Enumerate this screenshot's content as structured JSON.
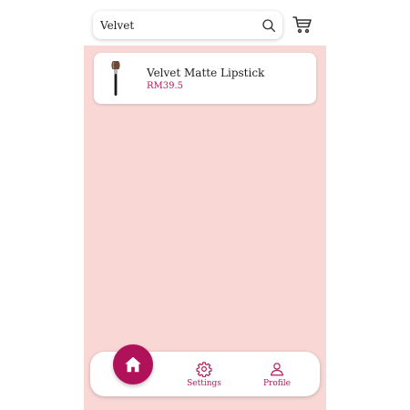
{
  "search": {
    "value": "Velvet",
    "placeholder": ""
  },
  "header": {
    "search_icon": "search-icon",
    "cart_icon": "cart-icon"
  },
  "results": [
    {
      "name": "Velvet Matte Lipstick",
      "price": "RM39.5",
      "image_icon": "makeup-brush-icon"
    }
  ],
  "nav": {
    "home_icon": "home-icon",
    "items": [
      {
        "label": "Settings",
        "icon": "gear-icon"
      },
      {
        "label": "Profile",
        "icon": "user-icon"
      }
    ]
  },
  "colors": {
    "accent": "#b0125a",
    "price": "#b31b5c",
    "background": "#f8d7d5"
  }
}
